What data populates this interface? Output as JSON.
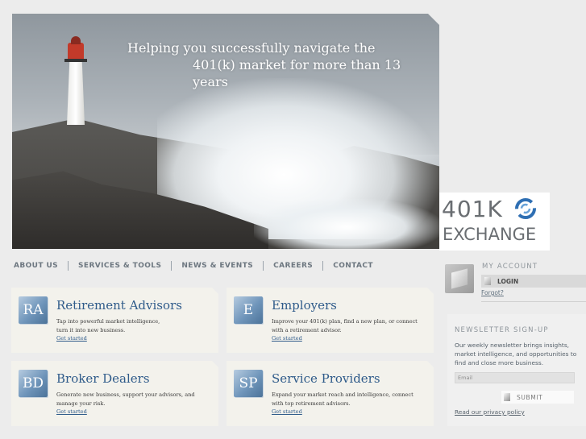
{
  "hero": {
    "line1": "Helping you successfully navigate the",
    "line2": "401(k) market for more than 13 years"
  },
  "logo": {
    "line1": "401K",
    "line2": "EXCHANGE",
    "accent": "#2f6fb3"
  },
  "nav": {
    "items": [
      {
        "label": "ABOUT US"
      },
      {
        "label": "SERVICES & TOOLS"
      },
      {
        "label": "NEWS & EVENTS"
      },
      {
        "label": "CAREERS"
      },
      {
        "label": "CONTACT"
      }
    ]
  },
  "cards": [
    {
      "badge": "RA",
      "title": "Retirement Advisors",
      "desc": "Tap into powerful market intelligence,\nturn it into new business.",
      "cta": "Get started"
    },
    {
      "badge": "E",
      "title": "Employers",
      "desc": "Improve your 401(k) plan, find a new plan, or connect with a retirement advisor.",
      "cta": "Get started"
    },
    {
      "badge": "BD",
      "title": "Broker Dealers",
      "desc": "Generate new business, support your advisors, and manage your risk.",
      "cta": "Get started"
    },
    {
      "badge": "SP",
      "title": "Service Providers",
      "desc": "Expand your market reach and intelligence, connect with top retirement advisors.",
      "cta": "Get started"
    }
  ],
  "account": {
    "header": "MY ACCOUNT",
    "login_label": "LOGIN",
    "forgot_label": "Forgot?"
  },
  "newsletter": {
    "header": "NEWSLETTER SIGN-UP",
    "body": "Our weekly newsletter brings insights, market intelligence, and opportunities to find and close more business.",
    "email_placeholder": "Email",
    "submit_label": "SUBMIT",
    "privacy_label": "Read our privacy policy"
  },
  "colors": {
    "title_blue": "#2f5b8a",
    "nav_gray": "#6d7780",
    "card_bg": "#f3f2ec"
  }
}
